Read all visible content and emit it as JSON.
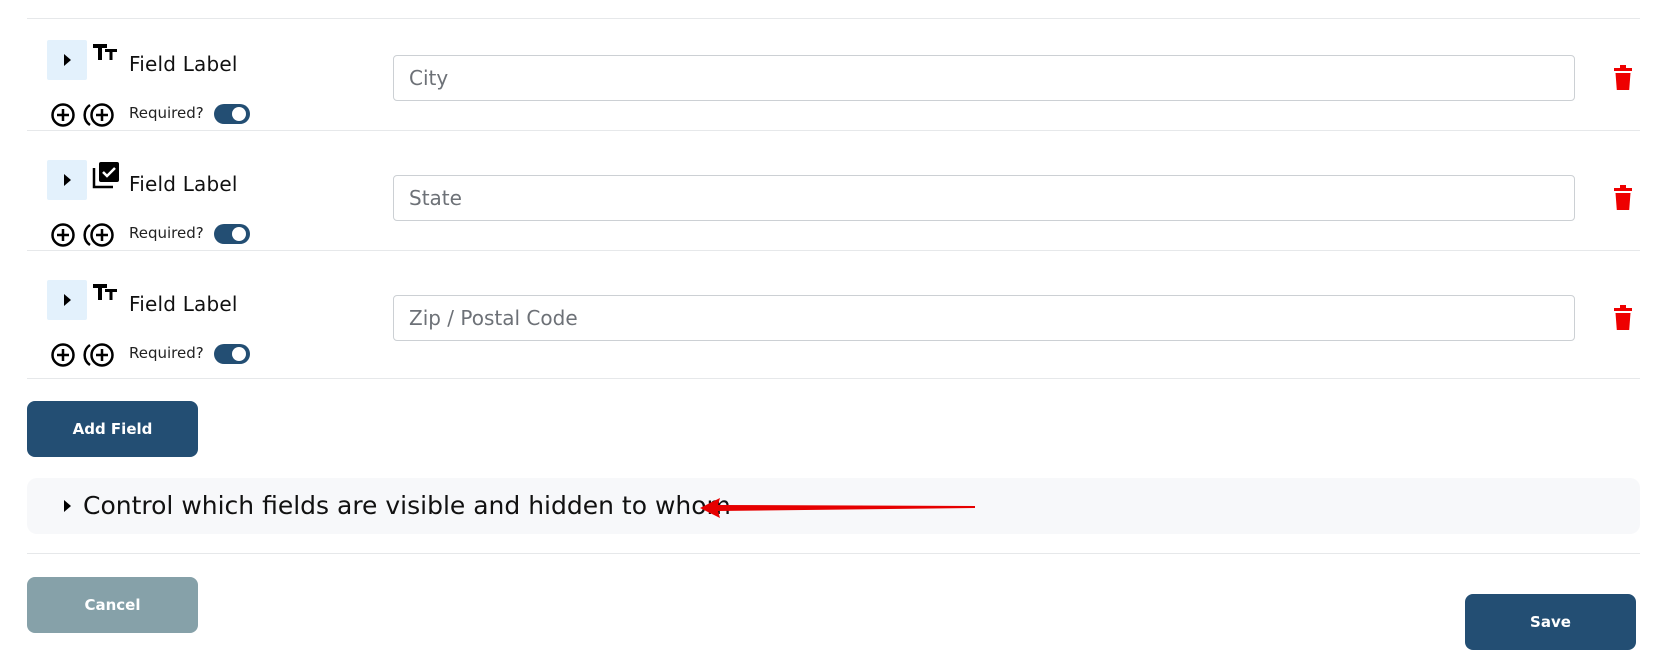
{
  "fields": [
    {
      "label": "Field Label",
      "type_icon": "text-type-icon",
      "required_label": "Required?",
      "required": true,
      "placeholder": "City",
      "value": ""
    },
    {
      "label": "Field Label",
      "type_icon": "checkbox-type-icon",
      "required_label": "Required?",
      "required": true,
      "placeholder": "State",
      "value": ""
    },
    {
      "label": "Field Label",
      "type_icon": "text-type-icon",
      "required_label": "Required?",
      "required": true,
      "placeholder": "Zip / Postal Code",
      "value": ""
    }
  ],
  "actions": {
    "add_field_label": "Add Field",
    "cancel_label": "Cancel",
    "save_label": "Save"
  },
  "visibility": {
    "label": "Control which fields are visible and hidden to whom"
  },
  "colors": {
    "primary": "#234e73",
    "cancel": "#86a1a9",
    "delete": "#ee0000",
    "annotation": "#e60000",
    "expander_bg": "#e3f1fc"
  }
}
